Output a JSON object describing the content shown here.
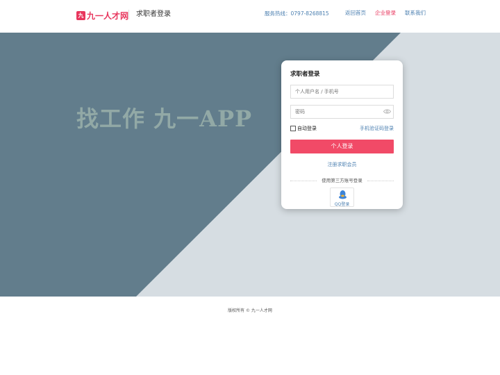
{
  "header": {
    "logo_mark": "九",
    "logo_text": "九一人才网",
    "page_title": "求职者登录",
    "hotline": "服务热线：0797-8268815",
    "nav": {
      "home": "返回首页",
      "company": "企业登录",
      "contact": "联系我们"
    }
  },
  "hero": {
    "slogan": "找工作 九一APP",
    "colors": {
      "dark": "#627d8c",
      "light": "#d6dde2"
    }
  },
  "login": {
    "title": "求职者登录",
    "username_placeholder": "个人用户名 / 手机号",
    "password_placeholder": "密码",
    "auto_login_label": "自动登录",
    "sms_login_link": "手机验证码登录",
    "submit_label": "个人登录",
    "register_link": "注册求职会员",
    "third_party_label": "使用第三方账号登录",
    "qq_label": "QQ登录"
  },
  "footer": {
    "copyright": "版权所有 © 九一人才网"
  }
}
